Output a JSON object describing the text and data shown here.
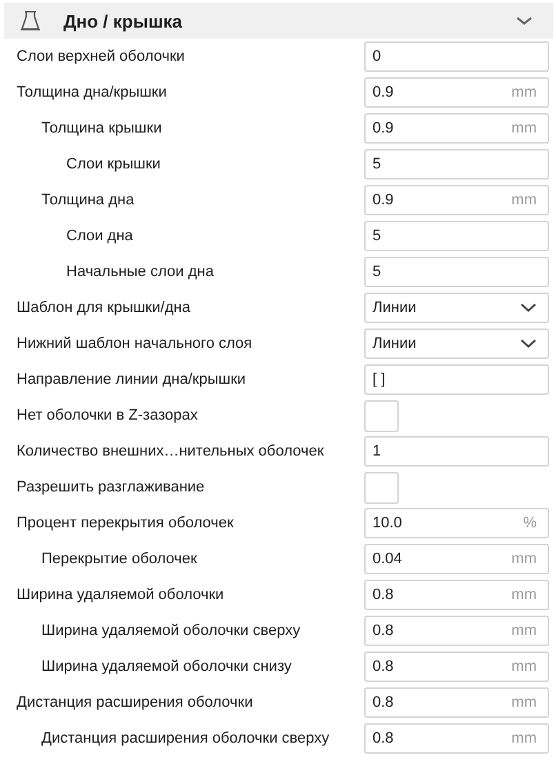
{
  "section": {
    "title": "Дно / крышка",
    "expanded": true
  },
  "settings": [
    {
      "label": "Слои верхней оболочки",
      "kind": "field",
      "value": "0"
    },
    {
      "label": "Толщина дна/крышки",
      "kind": "field",
      "value": "0.9",
      "unit": "mm",
      "children": [
        {
          "label": "Толщина крышки",
          "kind": "field",
          "value": "0.9",
          "unit": "mm",
          "children": [
            {
              "label": "Слои крышки",
              "kind": "field",
              "value": "5"
            }
          ]
        },
        {
          "label": "Толщина дна",
          "kind": "field",
          "value": "0.9",
          "unit": "mm",
          "children": [
            {
              "label": "Слои дна",
              "kind": "field",
              "value": "5"
            },
            {
              "label": "Начальные слои дна",
              "kind": "field",
              "value": "5"
            }
          ]
        }
      ]
    },
    {
      "label": "Шаблон для крышки/дна",
      "kind": "select",
      "value": "Линии"
    },
    {
      "label": "Нижний шаблон начального слоя",
      "kind": "select",
      "value": "Линии"
    },
    {
      "label": "Направление линии дна/крышки",
      "kind": "field",
      "value": "[ ]"
    },
    {
      "label": "Нет оболочки в Z-зазорах",
      "kind": "checkbox",
      "checked": false
    },
    {
      "label": "Количество внешних…нительных оболочек",
      "kind": "field",
      "value": "1"
    },
    {
      "label": "Разрешить разглаживание",
      "kind": "checkbox",
      "checked": false
    },
    {
      "label": "Процент перекрытия оболочек",
      "kind": "field",
      "value": "10.0",
      "unit": "%",
      "children": [
        {
          "label": "Перекрытие оболочек",
          "kind": "field",
          "value": "0.04",
          "unit": "mm"
        }
      ]
    },
    {
      "label": "Ширина удаляемой оболочки",
      "kind": "field",
      "value": "0.8",
      "unit": "mm",
      "children": [
        {
          "label": "Ширина удаляемой оболочки сверху",
          "kind": "field",
          "value": "0.8",
          "unit": "mm"
        },
        {
          "label": "Ширина удаляемой оболочки снизу",
          "kind": "field",
          "value": "0.8",
          "unit": "mm"
        }
      ]
    },
    {
      "label": "Дистанция расширения оболочки",
      "kind": "field",
      "value": "0.8",
      "unit": "mm",
      "children": [
        {
          "label": "Дистанция расширения оболочки сверху",
          "kind": "field",
          "value": "0.8",
          "unit": "mm"
        }
      ]
    }
  ]
}
